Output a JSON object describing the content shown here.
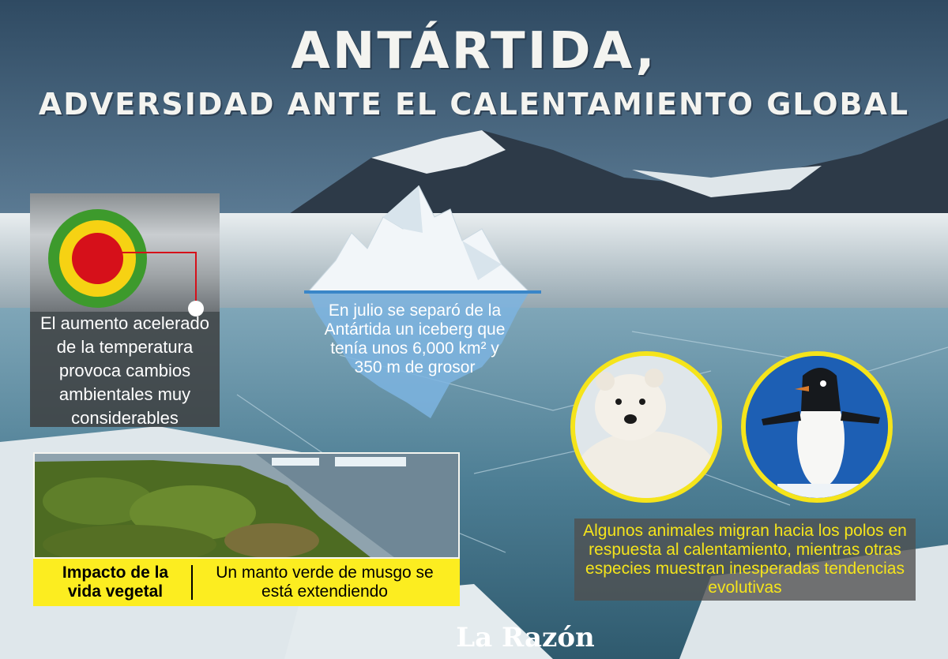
{
  "title": {
    "main": "Antártida,",
    "sub": "Adversidad ante el calentamiento global"
  },
  "temperature": {
    "text": "El aumento acelerado de la temperatura provoca cambios ambientales muy considerables",
    "colors": [
      "#3d9a2c",
      "#f6d213",
      "#d6101a"
    ]
  },
  "iceberg": {
    "text": "En julio se separó de la Antártida un iceberg que tenía unos 6,000 km²  y 350 m de grosor"
  },
  "plant": {
    "heading": "Impacto de la vida vegetal",
    "text": "Un manto verde de musgo se está extendiendo"
  },
  "animals": {
    "text": "Algunos animales migran hacia los polos en respuesta al calentamiento, mientras otras especies muestran inesperadas tendencias evolutivas",
    "items": [
      "polar-bear",
      "penguin"
    ]
  },
  "brand": "La Razón",
  "colors": {
    "accent_yellow": "#f5e41b",
    "bar_yellow": "#fced20"
  }
}
